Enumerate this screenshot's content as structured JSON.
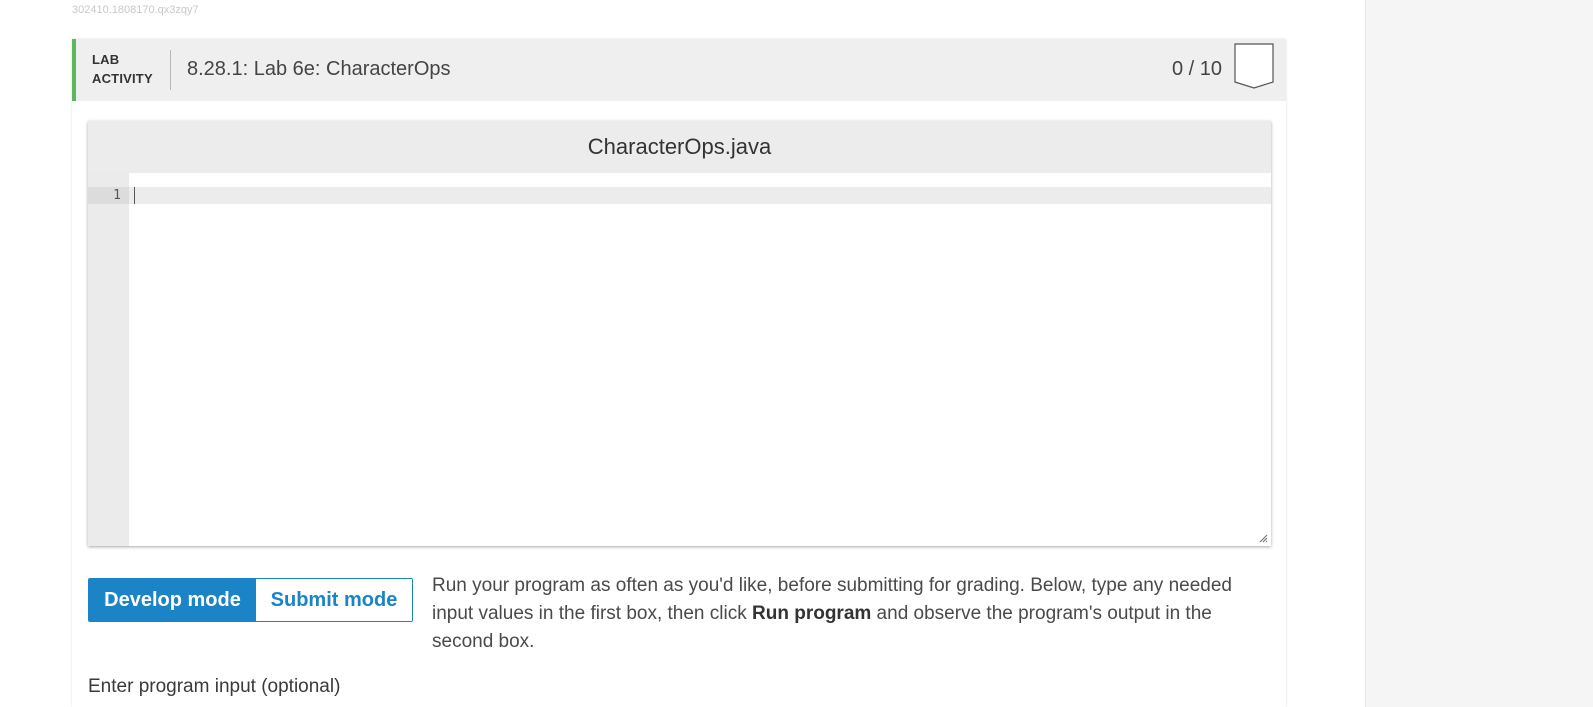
{
  "activity_id": "302410.1808170.qx3zqy7",
  "header": {
    "tag_line1": "LAB",
    "tag_line2": "ACTIVITY",
    "title": "8.28.1: Lab 6e: CharacterOps",
    "score": "0 / 10"
  },
  "editor": {
    "filename": "CharacterOps.java",
    "line_numbers": [
      "1"
    ],
    "code": ""
  },
  "modes": {
    "develop_label": "Develop mode",
    "submit_label": "Submit mode",
    "selected": "Develop mode"
  },
  "instructions": {
    "before": "Run your program as often as you'd like, before submitting for grading. Below, type any needed input values in the first box, then click ",
    "bold": "Run program",
    "after": " and observe the program's output in the second box."
  },
  "input_section": {
    "label": "Enter program input (optional)"
  },
  "colors": {
    "accent_green": "#5cb85c",
    "primary_blue": "#1a84c7"
  }
}
